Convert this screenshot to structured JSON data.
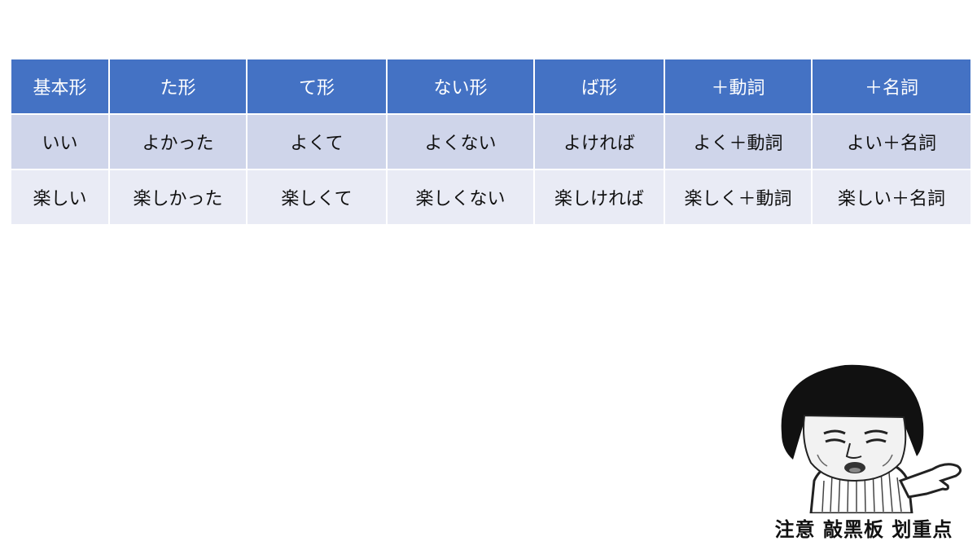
{
  "table": {
    "headers": [
      "基本形",
      "た形",
      "て形",
      "ない形",
      "ば形",
      "＋動詞",
      "＋名詞"
    ],
    "rows": [
      [
        "いい",
        "よかった",
        "よくて",
        "よくない",
        "よければ",
        "よく＋動詞",
        "よい＋名詞"
      ],
      [
        "楽しい",
        "楽しかった",
        "楽しくて",
        "楽しくない",
        "楽しければ",
        "楽しく＋動詞",
        "楽しい＋名詞"
      ]
    ]
  },
  "meme": {
    "caption": "注意 敲黑板 划重点"
  },
  "colors": {
    "header_bg": "#4472c4",
    "row1_bg": "#cfd5ea",
    "row2_bg": "#e9ebf5"
  }
}
